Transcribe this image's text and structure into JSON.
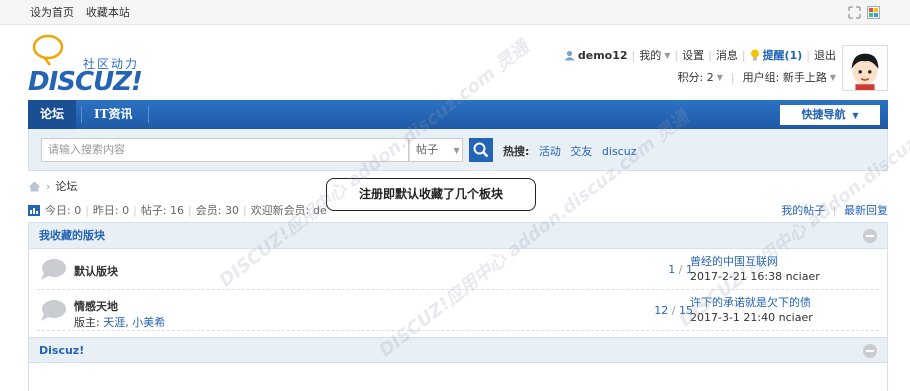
{
  "topbar": {
    "set_home": "设为首页",
    "bookmark": "收藏本站"
  },
  "logo": {
    "cn": "社区动力",
    "en": "DISCUZ!"
  },
  "user": {
    "name": "demo12",
    "mine": "我的",
    "settings": "设置",
    "messages": "消息",
    "notify": "提醒(1)",
    "logout": "退出",
    "points": "积分: 2",
    "group": "用户组: 新手上路"
  },
  "nav": {
    "items": [
      "论坛",
      "IT资讯"
    ],
    "quick_nav": "快捷导航"
  },
  "search": {
    "placeholder": "请输入搜索内容",
    "type": "帖子",
    "hot_label": "热搜:",
    "hot_terms": [
      "活动",
      "交友",
      "discuz"
    ]
  },
  "breadcrumb": {
    "current": "论坛"
  },
  "stats": {
    "today": "今日: 0",
    "yesterday": "昨日: 0",
    "posts": "帖子: 16",
    "members": "会员: 30",
    "welcome": "欢迎新会员: de",
    "my_posts": "我的帖子",
    "latest": "最新回复"
  },
  "callout": "注册即默认收藏了几个板块",
  "favorites": {
    "title": "我收藏的版块",
    "forums": [
      {
        "name": "默认版块",
        "moderators": "",
        "threads": "1",
        "posts": "1",
        "last_title": "曾经的中国互联网",
        "last_meta": "2017-2-21 16:38 nciaer"
      },
      {
        "name": "情感天地",
        "moderators_label": "版主: ",
        "moderators": "天涯, 小美希",
        "threads": "12",
        "posts": "15",
        "last_title": "许下的承诺就是欠下的债",
        "last_meta": "2017-3-1 21:40 nciaer"
      }
    ]
  },
  "section2": {
    "title": "Discuz!"
  },
  "watermark": "DISCUZ!应用中心 addon.discuz.com 灵通",
  "colors": {
    "brand": "#2464b4",
    "nav_bg": "#2464b4",
    "header_bg": "#e8eff5"
  }
}
